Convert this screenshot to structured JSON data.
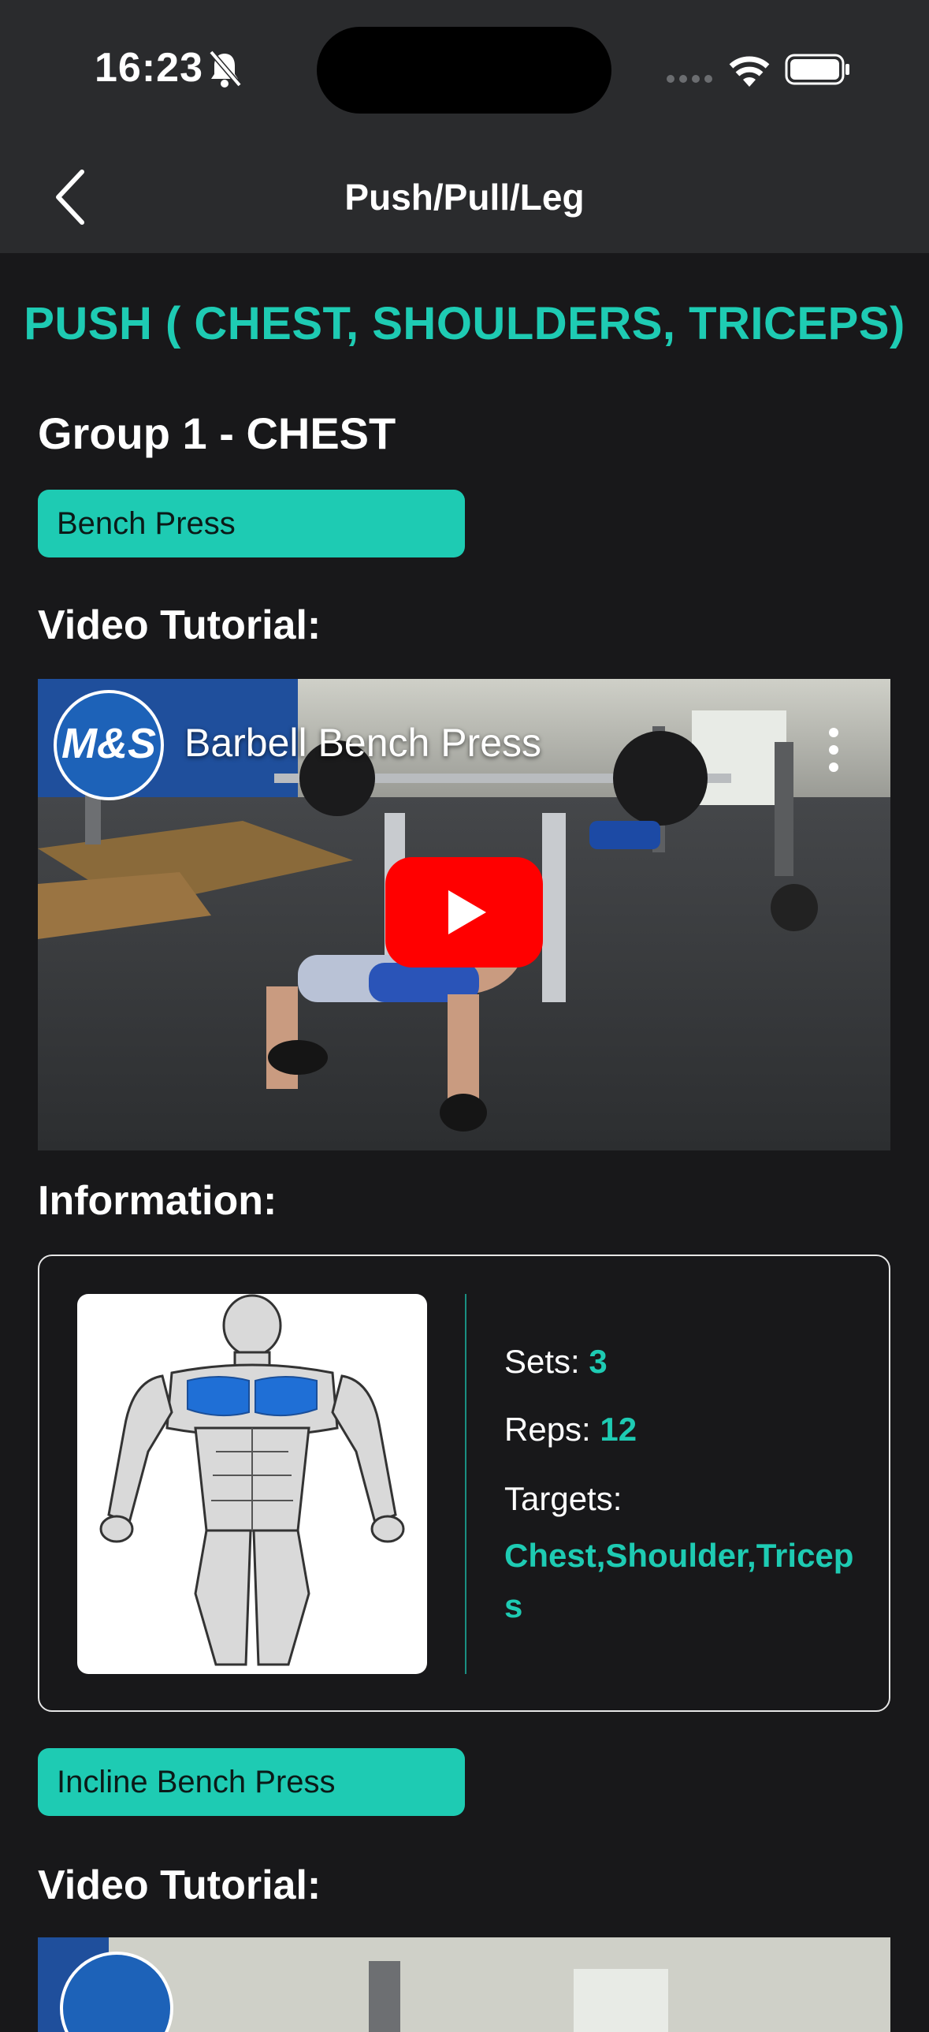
{
  "status_bar": {
    "time": "16:23"
  },
  "nav": {
    "title": "Push/Pull/Leg"
  },
  "day": {
    "title": "PUSH ( CHEST, SHOULDERS, TRICEPS)"
  },
  "group": {
    "title": "Group 1 - CHEST"
  },
  "exercises": [
    {
      "name": "Bench Press",
      "video_label": "Video Tutorial:",
      "video_title": "Barbell Bench Press",
      "channel_logo": "M&S",
      "info_label": "Information:",
      "sets_label": "Sets:",
      "sets": "3",
      "reps_label": "Reps:",
      "reps": "12",
      "targets_label": "Targets:",
      "targets": "Chest,Shoulder,Triceps"
    },
    {
      "name": "Incline Bench Press",
      "video_label": "Video Tutorial:"
    }
  ],
  "colors": {
    "accent": "#1ecbb3",
    "background": "#18181a",
    "bar": "#2a2b2d"
  },
  "icons": [
    "back-chevron-icon",
    "bell-slash-icon",
    "wifi-icon",
    "battery-icon",
    "play-icon",
    "more-vertical-icon"
  ]
}
